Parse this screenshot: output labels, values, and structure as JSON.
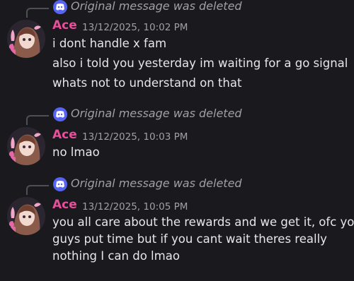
{
  "messages": [
    {
      "reply_text": "Original message was deleted",
      "author": "Ace",
      "timestamp": "13/12/2025, 10:02 PM",
      "lines": [
        "i dont handle x fam",
        "also i told you yesterday im waiting for a go signal",
        "whats not to understand on that"
      ]
    },
    {
      "reply_text": "Original message was deleted",
      "author": "Ace",
      "timestamp": "13/12/2025, 10:03 PM",
      "lines": [
        "no lmao"
      ]
    },
    {
      "reply_text": "Original message was deleted",
      "author": "Ace",
      "timestamp": "13/12/2025, 10:05 PM",
      "lines": [
        "you all care about the rewards and we get it, ofc you",
        "guys put time but if you cant wait theres really",
        "nothing I can do lmao"
      ]
    }
  ],
  "colors": {
    "background": "#1a1a1e",
    "author": "#e84f9a",
    "discord_blurple": "#5865f2",
    "muted": "#9ea0a6"
  },
  "icons": {
    "reply": "discord-logo-icon",
    "avatar": "anime-girl-avatar"
  }
}
